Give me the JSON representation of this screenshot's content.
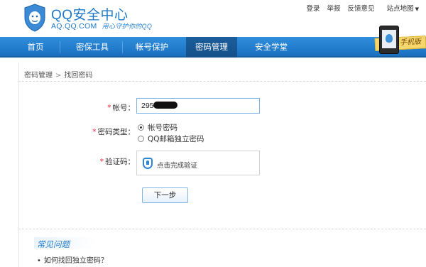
{
  "header": {
    "brand_title": "QQ安全中心",
    "brand_domain": "AQ.QQ.COM",
    "brand_slogan": "用心守护你的QQ",
    "top_links": [
      "登录",
      "举报",
      "反馈意见",
      "站点地图"
    ],
    "handset_tag": "手机版"
  },
  "nav": {
    "items": [
      "首页",
      "密保工具",
      "帐号保护",
      "密码管理",
      "安全学堂"
    ],
    "active": "密码管理"
  },
  "breadcrumb": {
    "parent": "密码管理",
    "separator": ">",
    "current": "找回密码"
  },
  "form": {
    "required_mark": "*",
    "account_label": "帐号：",
    "account_value": "295 86",
    "password_type_label": "密码类型：",
    "password_type_options": [
      "帐号密码",
      "QQ邮箱独立密码"
    ],
    "password_type_selected": "帐号密码",
    "captcha_label": "验证码：",
    "captcha_text": "点击完成验证",
    "next_button": "下一步"
  },
  "faq": {
    "title": "常见问题",
    "items": [
      "如何找回独立密码？"
    ]
  },
  "colors": {
    "brand_blue": "#1d78c7",
    "nav_blue": "#2f8fdc",
    "nav_active": "#14508a",
    "required_red": "#ee2233"
  }
}
